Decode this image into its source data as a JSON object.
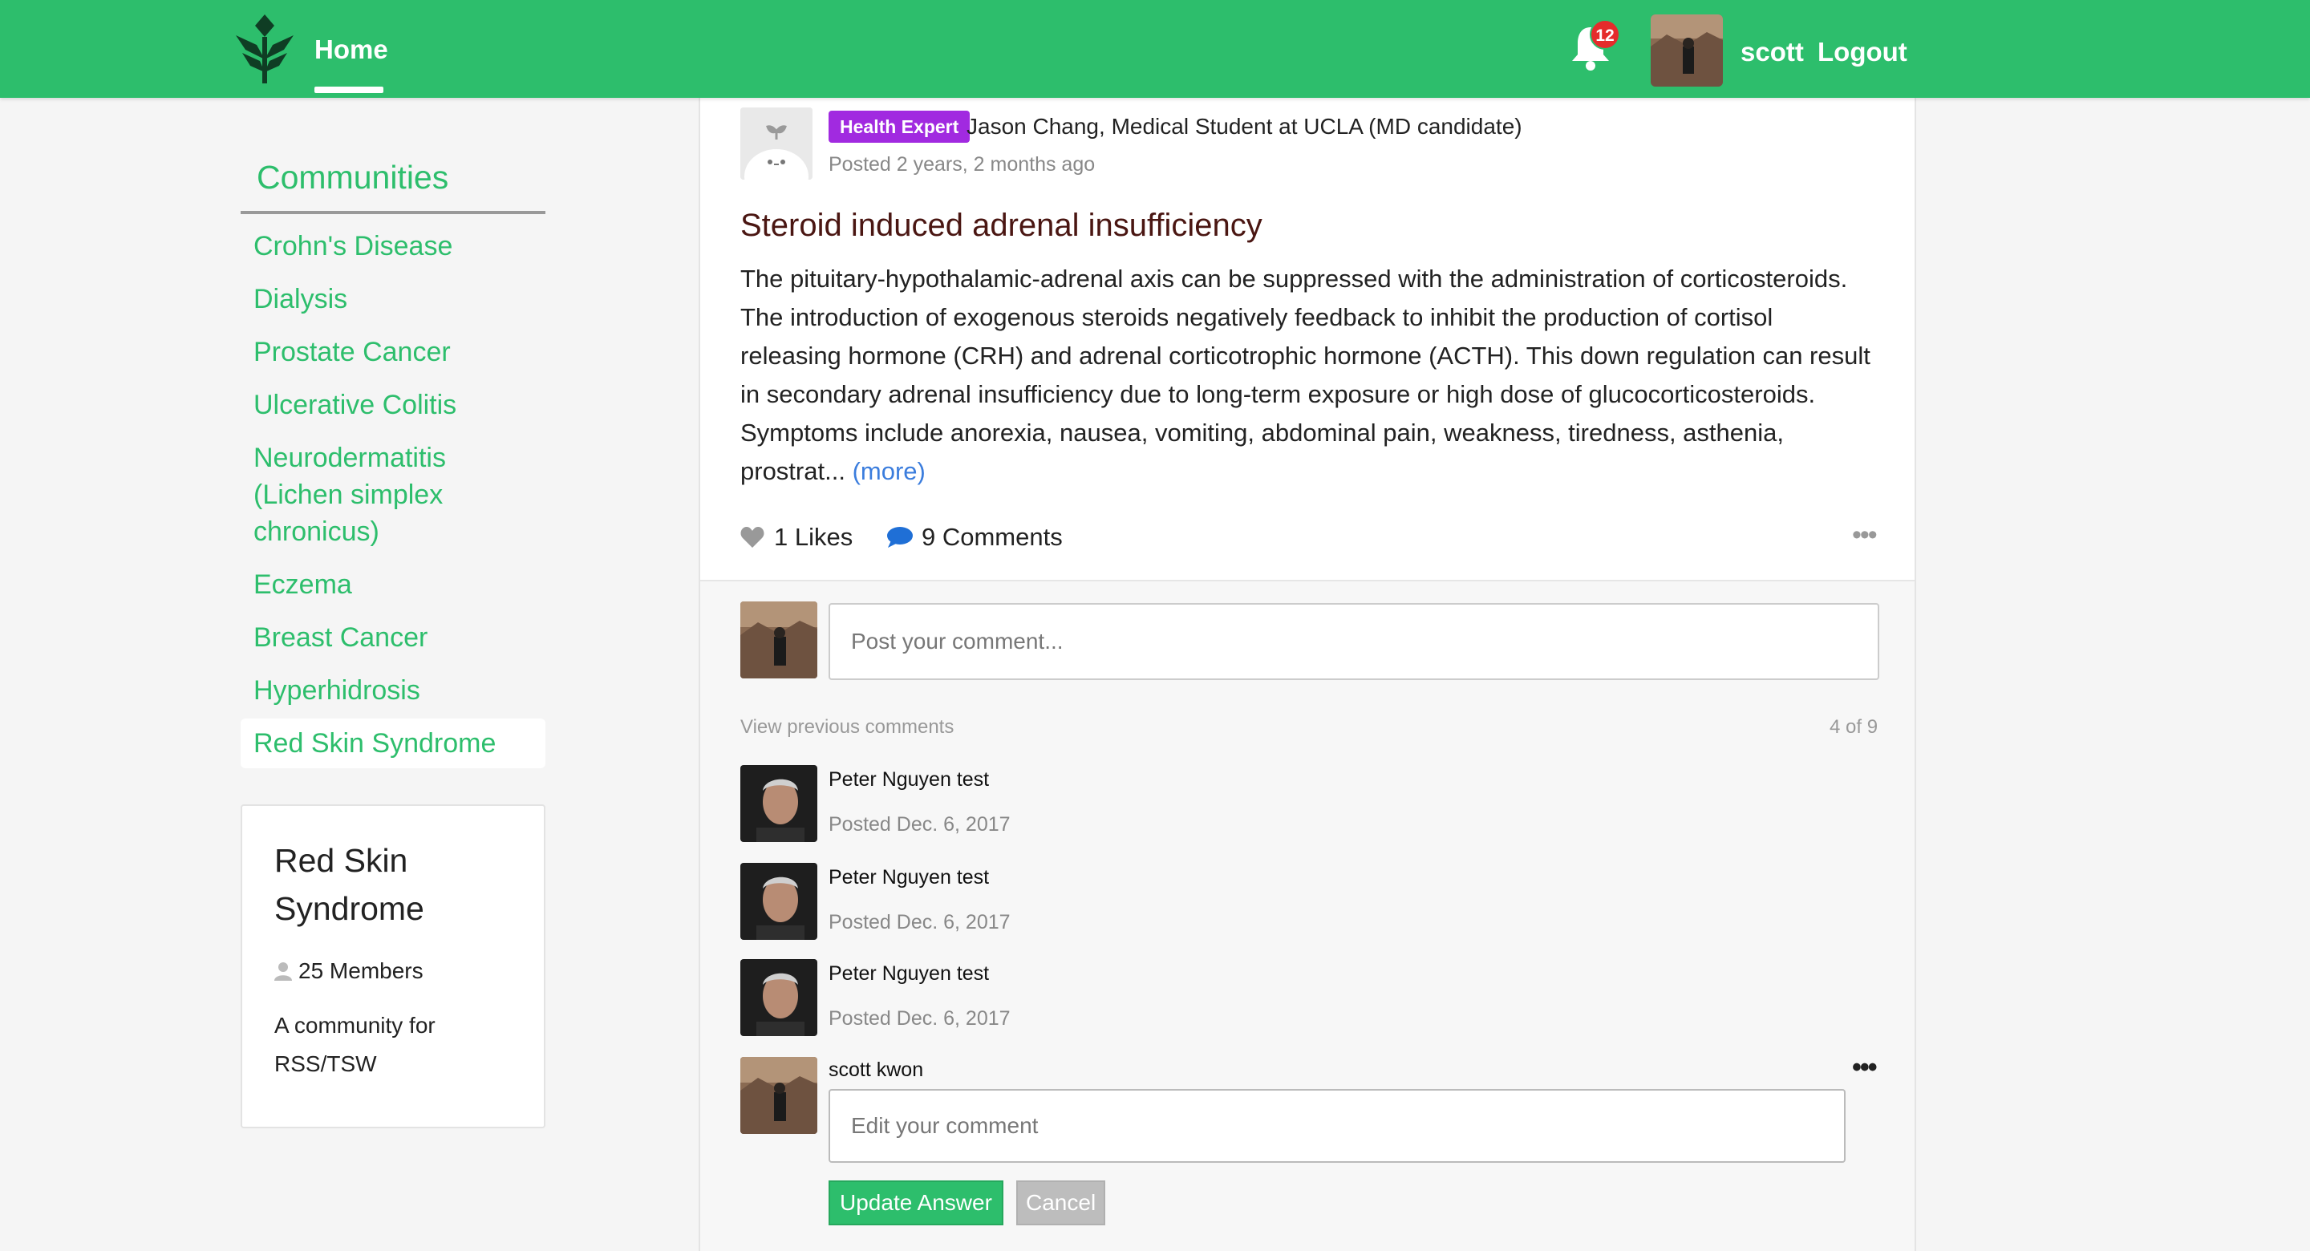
{
  "header": {
    "home_label": "Home",
    "notification_count": "12",
    "username": "scott",
    "logout_label": "Logout",
    "brand_color": "#2dbe6c"
  },
  "sidebar": {
    "title": "Communities",
    "items": [
      {
        "label": "Crohn's Disease"
      },
      {
        "label": "Dialysis"
      },
      {
        "label": "Prostate Cancer"
      },
      {
        "label": "Ulcerative Colitis"
      },
      {
        "label": "Neurodermatitis (Lichen simplex chronicus)"
      },
      {
        "label": "Eczema"
      },
      {
        "label": "Breast Cancer"
      },
      {
        "label": "Hyperhidrosis"
      },
      {
        "label": "Red Skin Syndrome",
        "active": true
      }
    ],
    "card": {
      "title": "Red Skin Syndrome",
      "members": "25 Members",
      "description": "A community for RSS/TSW"
    }
  },
  "post": {
    "badge": "Health Expert",
    "badge_color": "#a12ae0",
    "author": "Jason Chang, Medical Student at UCLA (MD candidate)",
    "posted": "Posted 2 years, 2 months ago",
    "title": "Steroid induced adrenal insufficiency",
    "body": "The pituitary-hypothalamic-adrenal axis can be suppressed with the administration of corticosteroids. The introduction of exogenous steroids negatively feedback to inhibit the production of cortisol releasing hormone (CRH) and adrenal corticotrophic hormone (ACTH). This down regulation can result in secondary adrenal insufficiency due to long-term exposure or high dose of glucocorticosteroids. Symptoms include anorexia, nausea, vomiting, abdominal pain, weakness, tiredness, asthenia, prostrat...",
    "more_label": "(more)",
    "likes": "1 Likes",
    "comments": "9 Comments"
  },
  "comments": {
    "input_placeholder": "Post your comment...",
    "view_previous": "View previous comments",
    "count": "4 of 9",
    "items": [
      {
        "author": "Peter Nguyen test",
        "date": "Posted Dec. 6, 2017"
      },
      {
        "author": "Peter Nguyen test",
        "date": "Posted Dec. 6, 2017"
      },
      {
        "author": "Peter Nguyen test",
        "date": "Posted Dec. 6, 2017"
      }
    ],
    "edit": {
      "author": "scott kwon",
      "placeholder": "Edit your comment",
      "update_label": "Update Answer",
      "cancel_label": "Cancel"
    }
  }
}
